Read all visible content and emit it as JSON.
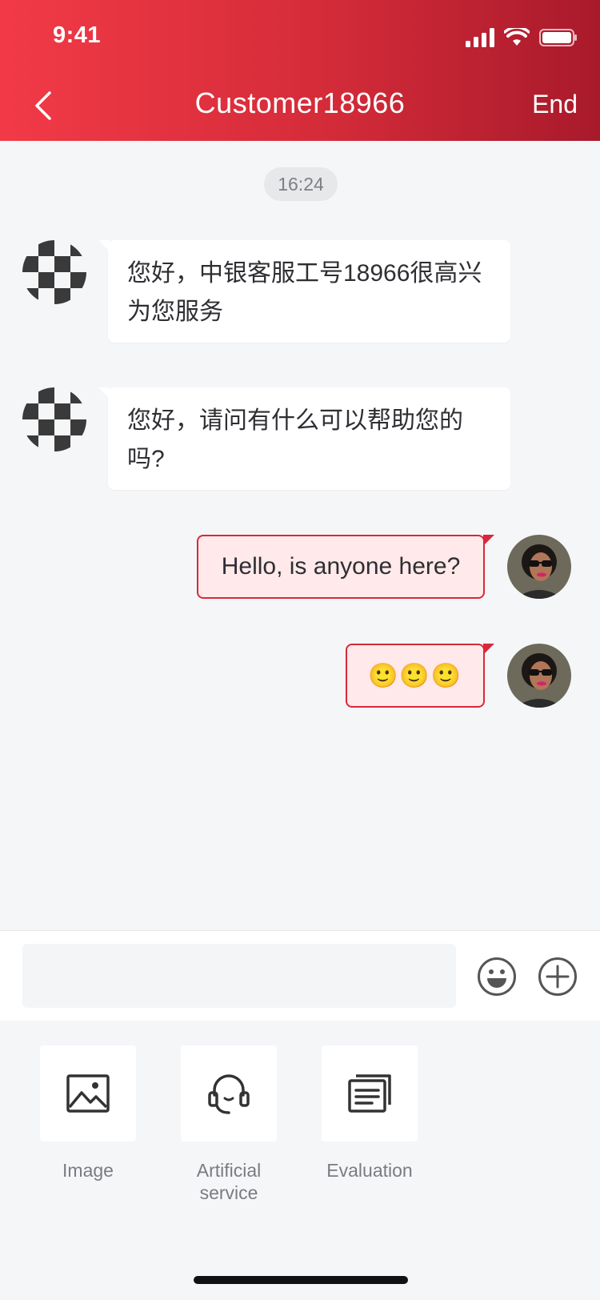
{
  "status_bar": {
    "time": "9:41"
  },
  "header": {
    "title": "Customer18966",
    "end_label": "End"
  },
  "chat": {
    "timestamp": "16:24",
    "messages": [
      {
        "from": "agent",
        "text": "您好，中银客服工号18966很高兴为您服务"
      },
      {
        "from": "agent",
        "text": "您好，请问有什么可以帮助您的吗?"
      },
      {
        "from": "user",
        "text": "Hello, is anyone here?"
      },
      {
        "from": "user",
        "text": "🙂🙂🙂"
      }
    ]
  },
  "input": {
    "value": "",
    "placeholder": ""
  },
  "panel": {
    "items": [
      {
        "label": "Image",
        "icon": "image-icon"
      },
      {
        "label": "Artificial service",
        "icon": "headset-icon"
      },
      {
        "label": "Evaluation",
        "icon": "document-stack-icon"
      }
    ]
  },
  "colors": {
    "brand_red": "#d8283a",
    "user_bubble": "#ffe9ea",
    "background": "#f5f6f8"
  }
}
